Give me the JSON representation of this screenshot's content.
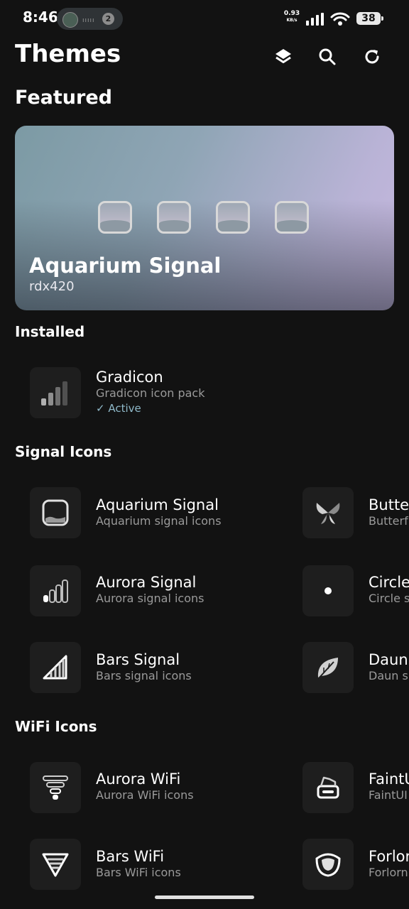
{
  "status": {
    "time": "8:46",
    "notif_count": "2",
    "net_speed_value": "0.93",
    "net_speed_unit": "KB/s",
    "battery": "38"
  },
  "header": {
    "title": "Themes"
  },
  "featured": {
    "heading": "Featured",
    "title": "Aquarium Signal",
    "author": "rdx420"
  },
  "installed": {
    "heading": "Installed",
    "items": [
      {
        "title": "Gradicon",
        "subtitle": "Gradicon icon pack",
        "status": "✓ Active",
        "icon": "signal-bars-gradient-icon"
      }
    ]
  },
  "signal_icons": {
    "heading": "Signal Icons",
    "items": [
      {
        "title": "Aquarium Signal",
        "subtitle": "Aquarium signal icons",
        "icon": "aquarium-square-icon"
      },
      {
        "title": "Butte",
        "subtitle": "Butterf",
        "icon": "butterfly-icon"
      },
      {
        "title": "Aurora Signal",
        "subtitle": "Aurora signal icons",
        "icon": "aurora-bars-icon"
      },
      {
        "title": "Circle",
        "subtitle": "Circle s",
        "icon": "dot-icon"
      },
      {
        "title": "Bars Signal",
        "subtitle": "Bars signal icons",
        "icon": "bars-triangle-icon"
      },
      {
        "title": "Daun",
        "subtitle": "Daun si",
        "icon": "leaf-icon"
      }
    ]
  },
  "wifi_icons": {
    "heading": "WiFi Icons",
    "items": [
      {
        "title": "Aurora WiFi",
        "subtitle": "Aurora WiFi icons",
        "icon": "aurora-wifi-icon"
      },
      {
        "title": "FaintU",
        "subtitle": "FaintUI",
        "icon": "faint-wifi-icon"
      },
      {
        "title": "Bars WiFi",
        "subtitle": "Bars WiFi icons",
        "icon": "bars-wifi-icon"
      },
      {
        "title": "Forlor",
        "subtitle": "Forlorn",
        "icon": "forlorn-wifi-icon"
      }
    ]
  }
}
